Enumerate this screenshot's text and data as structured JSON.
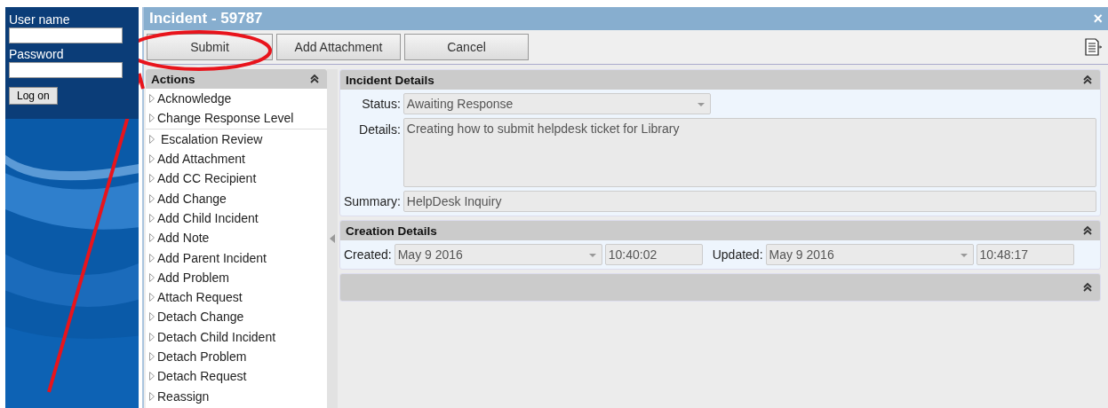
{
  "login": {
    "username_label": "User name",
    "password_label": "Password",
    "button": "Log on"
  },
  "window": {
    "title": "Incident - 59787",
    "close": "×"
  },
  "toolbar": {
    "buttons": [
      "Submit",
      "Add Attachment",
      "Cancel"
    ]
  },
  "actions": {
    "title": "Actions",
    "items": [
      {
        "label": "Acknowledge"
      },
      {
        "label": "Change Response Level"
      },
      {
        "label": " Escalation Review"
      },
      {
        "label": "Add Attachment"
      },
      {
        "label": "Add CC Recipient"
      },
      {
        "label": "Add Change"
      },
      {
        "label": "Add Child Incident"
      },
      {
        "label": "Add Note"
      },
      {
        "label": "Add Parent Incident"
      },
      {
        "label": "Add Problem"
      },
      {
        "label": "Attach Request"
      },
      {
        "label": "Detach Change"
      },
      {
        "label": "Detach Child Incident"
      },
      {
        "label": "Detach Problem"
      },
      {
        "label": "Detach Request"
      },
      {
        "label": "Reassign"
      }
    ]
  },
  "incident_details": {
    "title": "Incident Details",
    "status_label": "Status:",
    "status": "Awaiting Response",
    "details_label": "Details:",
    "details": "Creating how to submit helpdesk ticket for Library",
    "summary_label": "Summary:",
    "summary": "HelpDesk Inquiry"
  },
  "creation_details": {
    "title": "Creation Details",
    "created_label": "Created:",
    "created_date": "May 9 2016",
    "created_time": "10:40:02",
    "updated_label": "Updated:",
    "updated_date": "May 9 2016",
    "updated_time": "10:48:17"
  },
  "annotation": {
    "kind": "circle-arrow"
  }
}
